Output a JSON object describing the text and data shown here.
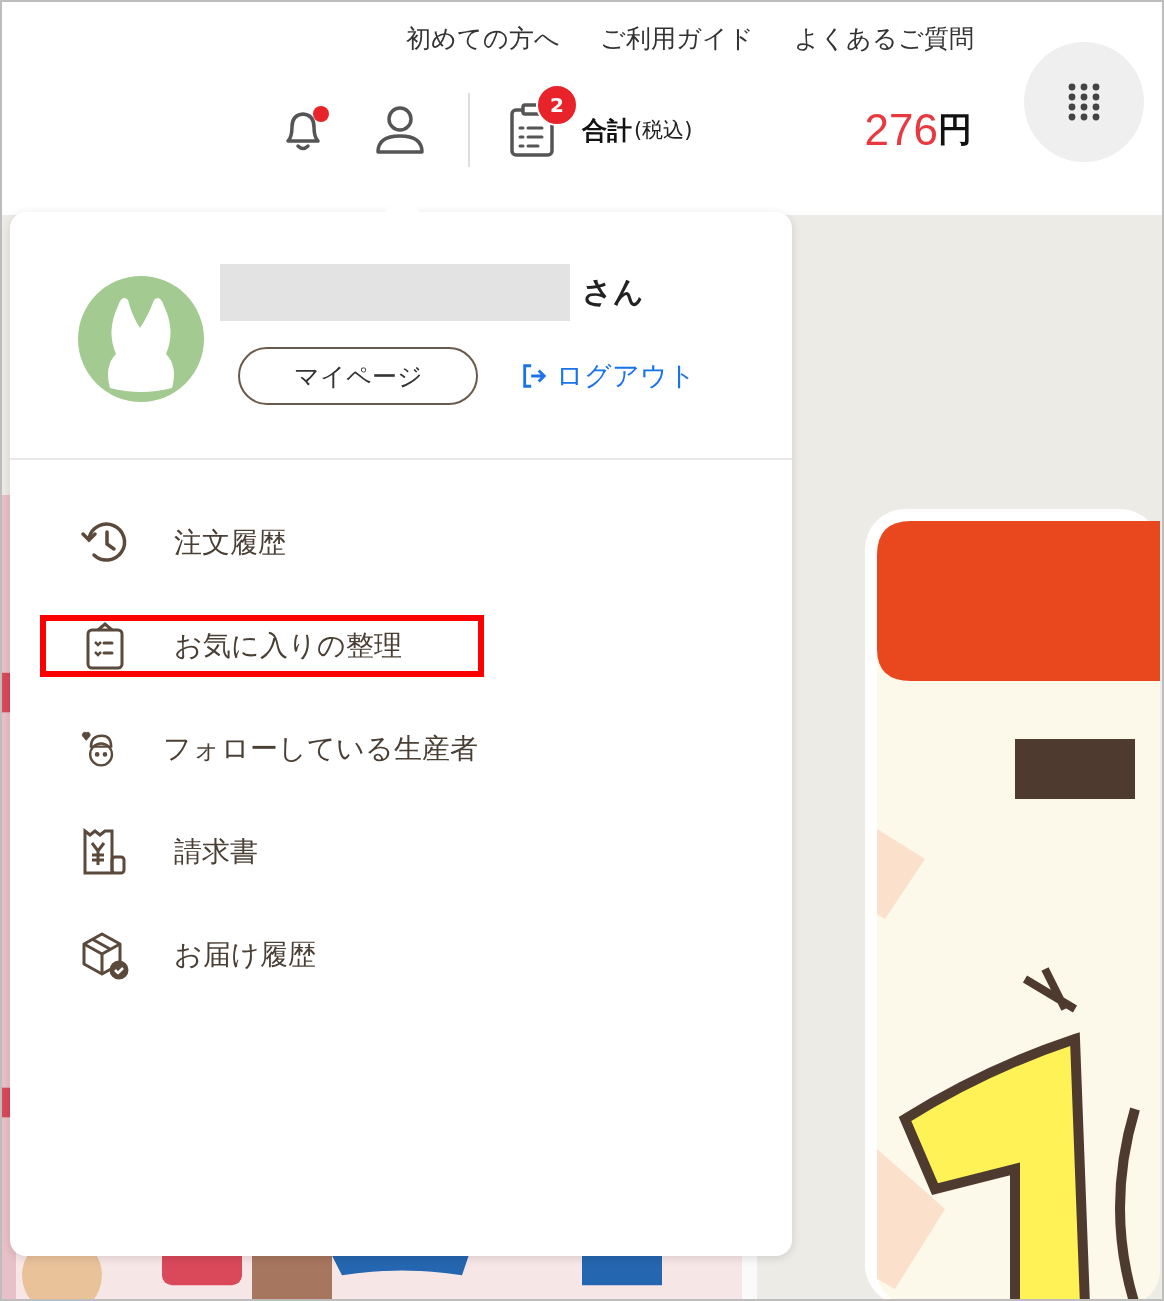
{
  "header": {
    "links": [
      "初めての方へ",
      "ご利用ガイド",
      "よくあるご質問"
    ],
    "notification": {
      "unread": true
    },
    "cart": {
      "count": "2",
      "label": "合計",
      "label_note": "(税込)",
      "amount": "276",
      "currency": "円"
    }
  },
  "account_menu": {
    "name_suffix": "さん",
    "mypage_button": "マイページ",
    "logout_link": "ログアウト",
    "items": [
      {
        "kind": "history",
        "label": "注文履歴",
        "highlighted": false
      },
      {
        "kind": "favorites",
        "label": "お気に入りの整理",
        "highlighted": true
      },
      {
        "kind": "producer",
        "label": "フォローしている生産者",
        "highlighted": false
      },
      {
        "kind": "invoice",
        "label": "請求書",
        "highlighted": false
      },
      {
        "kind": "delivery",
        "label": "お届け履歴",
        "highlighted": false
      }
    ]
  }
}
